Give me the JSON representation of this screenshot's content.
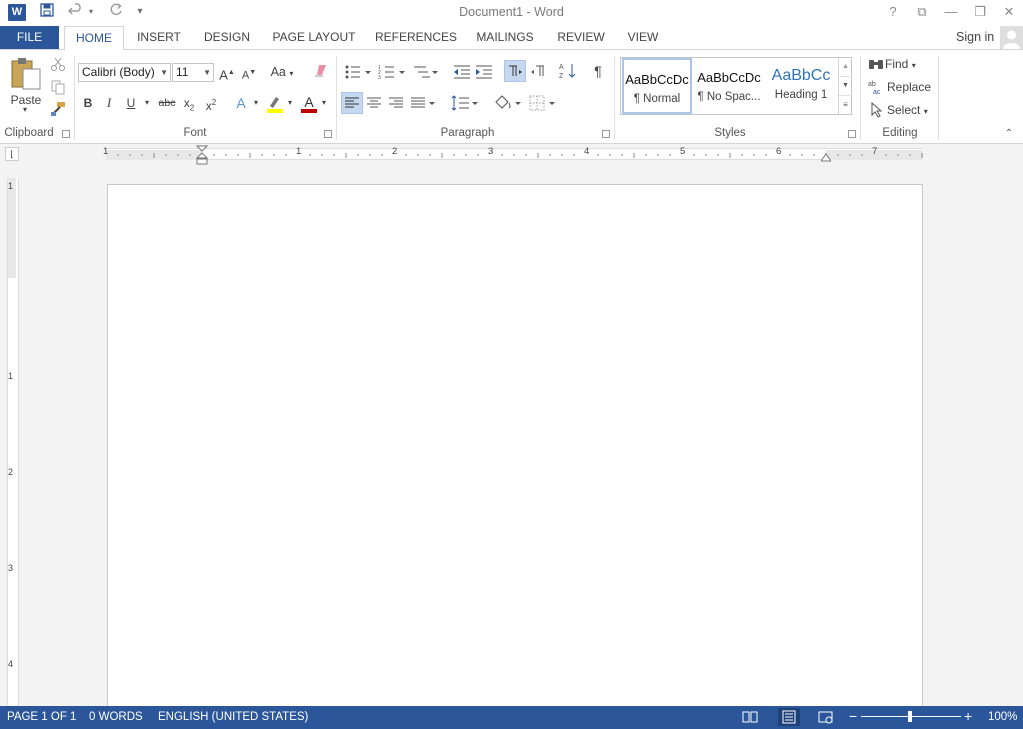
{
  "app": {
    "title": "Document1 - Word",
    "logo_letter": "W"
  },
  "quick_access": {
    "save_icon": "save-icon",
    "undo_icon": "undo-icon",
    "redo_icon": "redo-icon",
    "customize_icon": "customize-icon"
  },
  "window_controls": {
    "help": "?",
    "ribbon_display": "⧉",
    "minimize": "—",
    "restore": "❐",
    "close": "✕"
  },
  "tabs": {
    "file": "FILE",
    "home": "HOME",
    "insert": "INSERT",
    "design": "DESIGN",
    "page_layout": "PAGE LAYOUT",
    "references": "REFERENCES",
    "mailings": "MAILINGS",
    "review": "REVIEW",
    "view": "VIEW"
  },
  "account": {
    "signin": "Sign in"
  },
  "clipboard": {
    "paste": "Paste",
    "label": "Clipboard"
  },
  "font": {
    "name": "Calibri (Body)",
    "size": "11",
    "grow": "A",
    "shrink": "A",
    "case": "Aa",
    "bold": "B",
    "italic": "I",
    "underline": "U",
    "strikethrough": "abc",
    "subscript": "x",
    "sub_mark": "2",
    "superscript": "x",
    "sup_mark": "2",
    "text_effects": "A",
    "font_color": "A",
    "label": "Font"
  },
  "paragraph": {
    "pilcrow": "¶",
    "label": "Paragraph"
  },
  "styles": {
    "items": [
      {
        "preview": "AaBbCcDc",
        "name": "¶ Normal"
      },
      {
        "preview": "AaBbCcDc",
        "name": "¶ No Spac..."
      },
      {
        "preview": "AaBbCc",
        "name": "Heading 1"
      }
    ],
    "label": "Styles"
  },
  "editing": {
    "find": "Find",
    "replace": "Replace",
    "select": "Select",
    "label": "Editing"
  },
  "ruler": {
    "numbers": [
      "1",
      "1",
      "2",
      "3",
      "4",
      "5",
      "6",
      "7"
    ],
    "vertical_numbers": [
      "1",
      "1",
      "2",
      "3",
      "4"
    ]
  },
  "status": {
    "page": "PAGE 1 OF 1",
    "words": "0 WORDS",
    "language": "ENGLISH (UNITED STATES)",
    "zoom": "100%",
    "zoom_minus": "−",
    "zoom_plus": "+"
  },
  "colors": {
    "accent": "#2b579a",
    "highlight": "#ffff00",
    "font_color": "#c00000"
  }
}
